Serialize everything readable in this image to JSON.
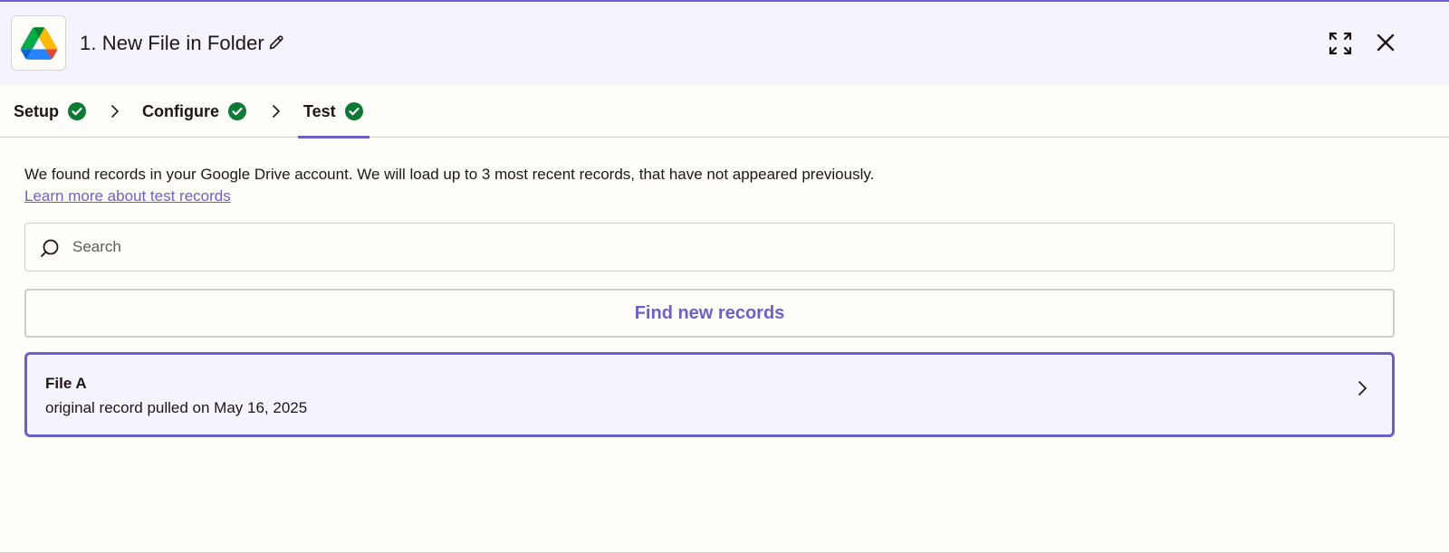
{
  "header": {
    "app_icon": "google-drive-icon",
    "title": "1. New File in Folder",
    "edit_icon": "pencil-icon",
    "expand_icon": "expand-icon",
    "close_icon": "close-icon"
  },
  "tabs": [
    {
      "label": "Setup",
      "status": "complete",
      "active": false
    },
    {
      "label": "Configure",
      "status": "complete",
      "active": false
    },
    {
      "label": "Test",
      "status": "complete",
      "active": true
    }
  ],
  "body": {
    "message": "We found records in your Google Drive account. We will load up to 3 most recent records, that have not appeared previously.",
    "learn_link": "Learn more about test records",
    "search": {
      "placeholder": "Search",
      "value": ""
    },
    "find_button": "Find new records",
    "records": [
      {
        "title": "File A",
        "subtitle": "original record pulled on May 16, 2025",
        "selected": true
      }
    ]
  },
  "colors": {
    "accent": "#6b5fd0",
    "success": "#0b7a33",
    "header_bg": "#f5f4fe",
    "page_bg": "#fffdf9"
  }
}
